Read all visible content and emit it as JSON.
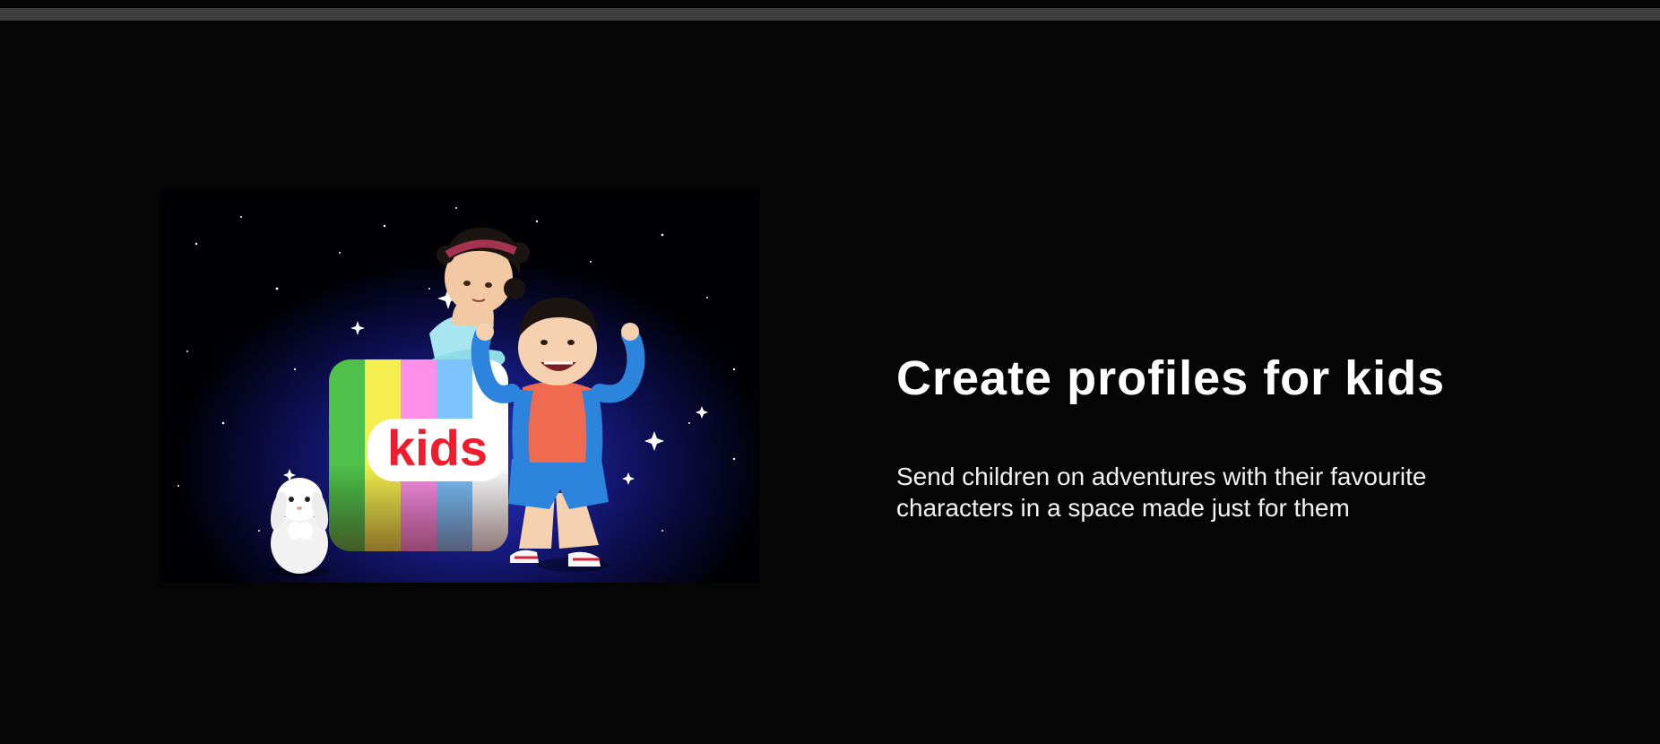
{
  "feature": {
    "title": "Create profiles for kids",
    "description": "Send children on adventures with their favourite characters in a space made just for them",
    "image": {
      "badge_text": "kids",
      "stripe_colors": [
        "#4fc04a",
        "#f4ef4e",
        "#ff8fe8",
        "#7cc3ff",
        "#ffffff"
      ],
      "badge_text_color": "#ee1c2c"
    }
  },
  "colors": {
    "background": "#050505",
    "divider": "#3f3f3f",
    "text": "#ffffff"
  }
}
